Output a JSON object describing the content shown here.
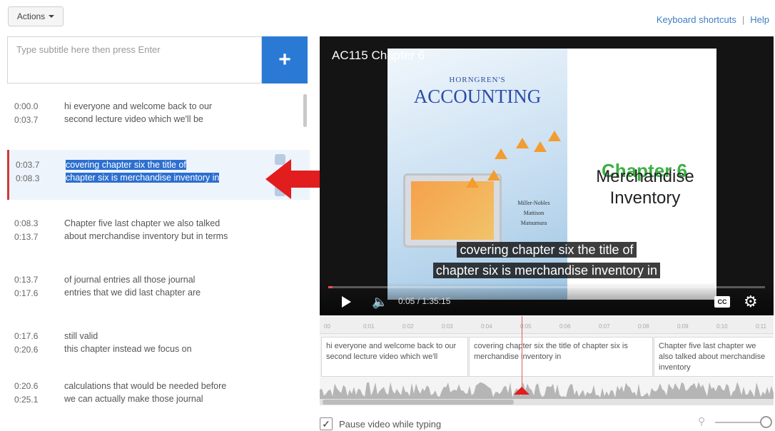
{
  "toolbar": {
    "actions_label": "Actions"
  },
  "links": {
    "keyboard_shortcuts": "Keyboard shortcuts",
    "separator": "|",
    "help": "Help"
  },
  "editor": {
    "input_placeholder": "Type subtitle here then press Enter",
    "add_label": "+"
  },
  "subtitles": [
    {
      "start": "0:00.0",
      "end": "0:03.7",
      "line1": "hi everyone and welcome back to our",
      "line2": "second lecture video which we'll be"
    },
    {
      "start": "0:03.7",
      "end": "0:08.3",
      "line1": "covering chapter six the title of",
      "line2": "chapter six is merchandise inventory in"
    },
    {
      "start": "0:08.3",
      "end": "0:13.7",
      "line1": "Chapter five last chapter we also talked",
      "line2": "about merchandise inventory but in terms"
    },
    {
      "start": "0:13.7",
      "end": "0:17.6",
      "line1": "of journal entries all those journal",
      "line2": "entries that we did last chapter are"
    },
    {
      "start": "0:17.6",
      "end": "0:20.6",
      "line1": "still valid",
      "line2": "this chapter instead we focus on"
    },
    {
      "start": "0:20.6",
      "end": "0:25.1",
      "line1": "calculations that would be needed before",
      "line2": "we can actually make those journal"
    }
  ],
  "video": {
    "title": "AC115 Chapter 6",
    "book_publisher": "HORNGREN'S",
    "book_title": "ACCOUNTING",
    "book_authors": [
      "Miller-Nobles",
      "Mattison",
      "Matsumura"
    ],
    "slide_chapter": "Chapter 6",
    "slide_subtitle_1": "Merchandise",
    "slide_subtitle_2": "Inventory",
    "caption_line1": "covering chapter six the title of",
    "caption_line2": "chapter six is merchandise inventory in",
    "time_display": "0:05 / 1:35:15",
    "progress": 0.01,
    "cc_label": "CC"
  },
  "timeline": {
    "ticks": [
      "00",
      "0:01",
      "0:02",
      "0:03",
      "0:04",
      "0:05",
      "0:06",
      "0:07",
      "0:08",
      "0:09",
      "0:10",
      "0:11"
    ],
    "segments": [
      {
        "text": "hi everyone and welcome back to our second lecture video which we'll"
      },
      {
        "text": "covering chapter six the title of chapter six is merchandise inventory in"
      },
      {
        "text": "Chapter five last chapter we also talked about merchandise inventory"
      }
    ]
  },
  "options": {
    "pause_label": "Pause video while typing",
    "pause_checked": true
  },
  "colors": {
    "accent_blue": "#2a7ad5",
    "highlight_red": "#d03a3a",
    "caption_bg": "#141414"
  }
}
